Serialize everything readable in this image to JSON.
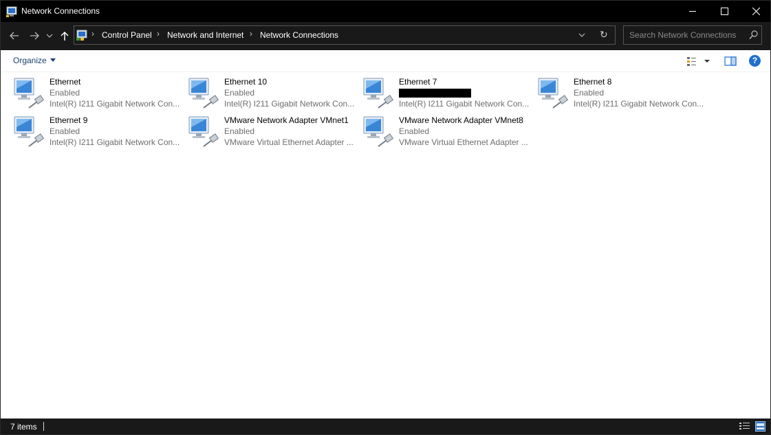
{
  "window": {
    "title": "Network Connections"
  },
  "nav": {
    "back_icon": "arrow-left-icon",
    "forward_icon": "arrow-right-icon",
    "recent_icon": "chevron-down-icon",
    "up_icon": "arrow-up-icon"
  },
  "address": {
    "breadcrumbs": [
      "Control Panel",
      "Network and Internet",
      "Network Connections"
    ],
    "separator": "›",
    "refresh_glyph": "↻"
  },
  "search": {
    "placeholder": "Search Network Connections"
  },
  "toolbar": {
    "organize_label": "Organize",
    "help_glyph": "?"
  },
  "connections": [
    {
      "name": "Ethernet",
      "status": "Enabled",
      "device": "Intel(R) I211 Gigabit Network Con..."
    },
    {
      "name": "Ethernet 10",
      "status": "Enabled",
      "device": "Intel(R) I211 Gigabit Network Con..."
    },
    {
      "name": "Ethernet 7",
      "status": "",
      "device": "Intel(R) I211 Gigabit Network Con..."
    },
    {
      "name": "Ethernet 8",
      "status": "Enabled",
      "device": "Intel(R) I211 Gigabit Network Con..."
    },
    {
      "name": "Ethernet 9",
      "status": "Enabled",
      "device": "Intel(R) I211 Gigabit Network Con..."
    },
    {
      "name": "VMware Network Adapter VMnet1",
      "status": "Enabled",
      "device": "VMware Virtual Ethernet Adapter ..."
    },
    {
      "name": "VMware Network Adapter VMnet8",
      "status": "Enabled",
      "device": "VMware Virtual Ethernet Adapter ..."
    }
  ],
  "statusbar": {
    "item_count": "7 items"
  },
  "colors": {
    "titlebar": "#000000",
    "navbar": "#191919",
    "link": "#1a3e72",
    "accent": "#1f6fd0"
  }
}
